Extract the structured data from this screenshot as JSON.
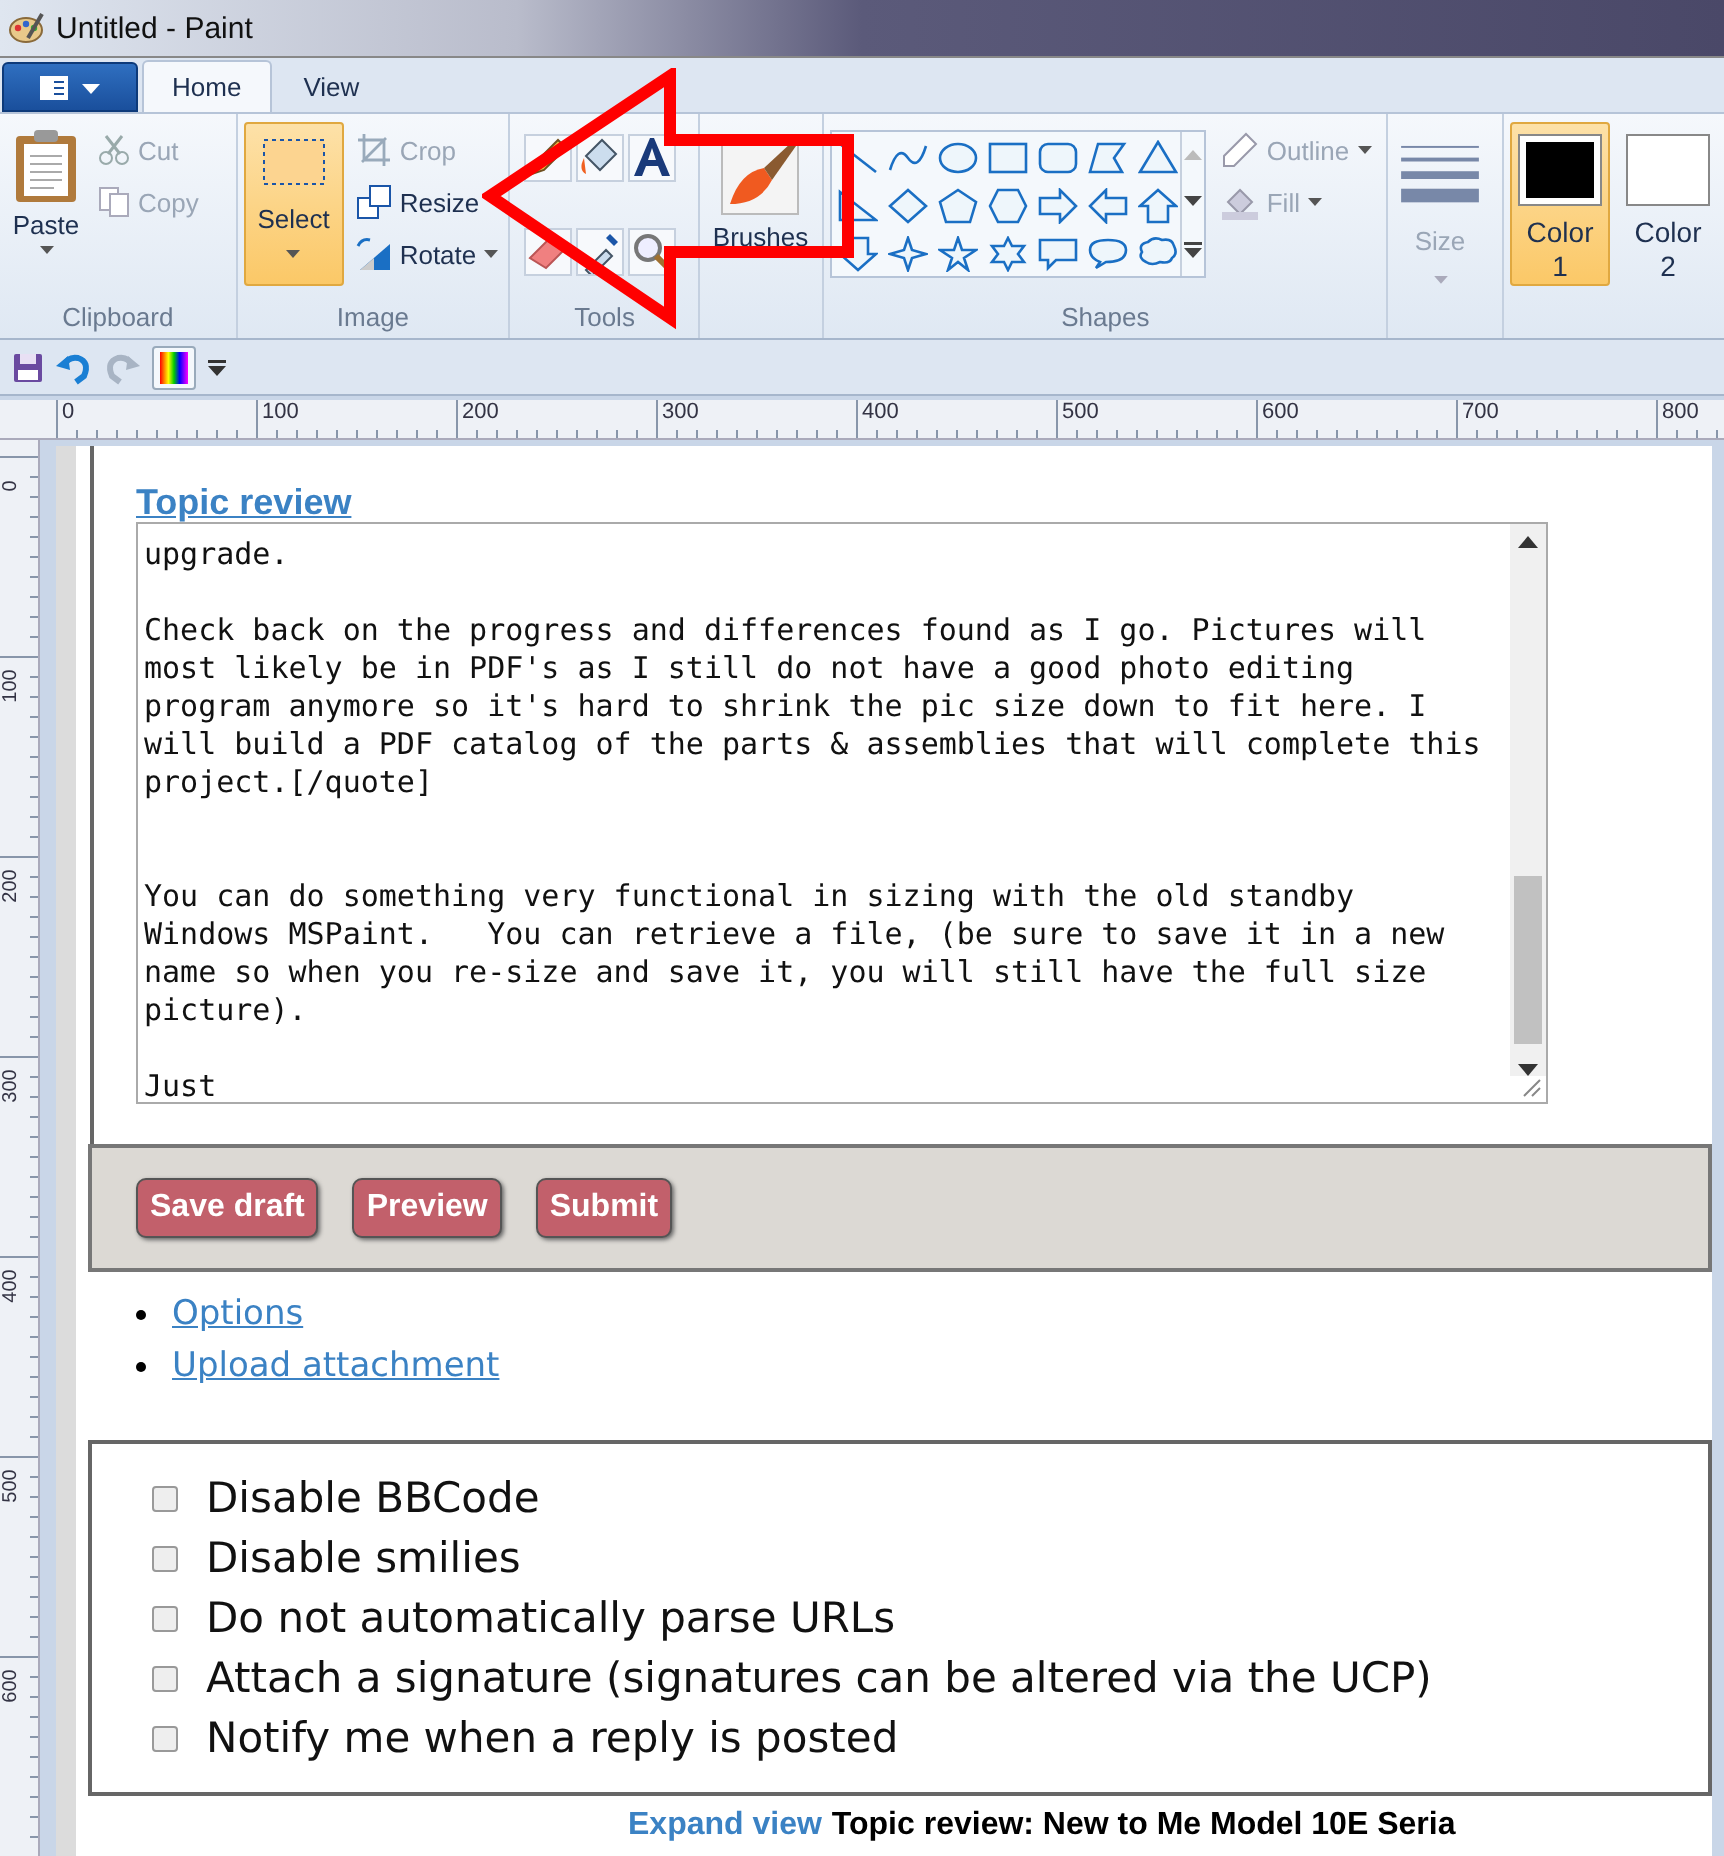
{
  "window": {
    "title": "Untitled - Paint"
  },
  "ribbon": {
    "tabs": [
      {
        "label": "Home",
        "selected": true
      },
      {
        "label": "View",
        "selected": false
      }
    ],
    "clipboard": {
      "label": "Clipboard",
      "paste": "Paste",
      "cut": {
        "label": "Cut",
        "disabled": true
      },
      "copy": {
        "label": "Copy",
        "disabled": true
      }
    },
    "image": {
      "label": "Image",
      "select": {
        "label": "Select",
        "selected": true
      },
      "crop": {
        "label": "Crop",
        "disabled": true
      },
      "resize": {
        "label": "Resize",
        "disabled": false
      },
      "rotate": {
        "label": "Rotate",
        "disabled": false
      }
    },
    "tools": {
      "label": "Tools"
    },
    "brushes": "Brushes",
    "shapes": {
      "label": "Shapes",
      "outline": {
        "label": "Outline",
        "disabled": true
      },
      "fill": {
        "label": "Fill",
        "disabled": true
      }
    },
    "size": {
      "label": "Size",
      "disabled": true
    },
    "colors": [
      {
        "label": "Color 1",
        "selected": true,
        "color": "#000000"
      },
      {
        "label": "Color 2",
        "selected": false,
        "color": "#ffffff"
      }
    ]
  },
  "ruler": {
    "horizontal": [
      "0",
      "100",
      "200",
      "300",
      "400",
      "500",
      "600",
      "700",
      "800"
    ],
    "vertical": [
      "0",
      "100",
      "200",
      "300",
      "400",
      "500",
      "600"
    ]
  },
  "canvas_page": {
    "heading": "Topic review",
    "editor_text": "upgrade.\n\nCheck back on the progress and differences found as I go. Pictures will\nmost likely be in PDF's as I still do not have a good photo editing\nprogram anymore so it's hard to shrink the pic size down to fit here. I\nwill build a PDF catalog of the parts & assemblies that will complete this\nproject.[/quote]\n\n\nYou can do something very functional in sizing with the old standby\nWindows MSPaint.   You can retrieve a file, (be sure to save it in a new\nname so when you re-size and save it, you will still have the full size\npicture).\n\nJust",
    "buttons": [
      "Save draft",
      "Preview",
      "Submit"
    ],
    "links": [
      "Options",
      "Upload attachment"
    ],
    "options": [
      {
        "label": "Disable BBCode",
        "checked": false
      },
      {
        "label": "Disable smilies",
        "checked": false
      },
      {
        "label": "Do not automatically parse URLs",
        "checked": false
      },
      {
        "label": "Attach a signature (signatures can be altered via the UCP)",
        "checked": false
      },
      {
        "label": "Notify me when a reply is posted",
        "checked": false
      }
    ],
    "footer": {
      "link": "Expand view",
      "title": "Topic review: New to Me Model 10E Seria"
    }
  }
}
